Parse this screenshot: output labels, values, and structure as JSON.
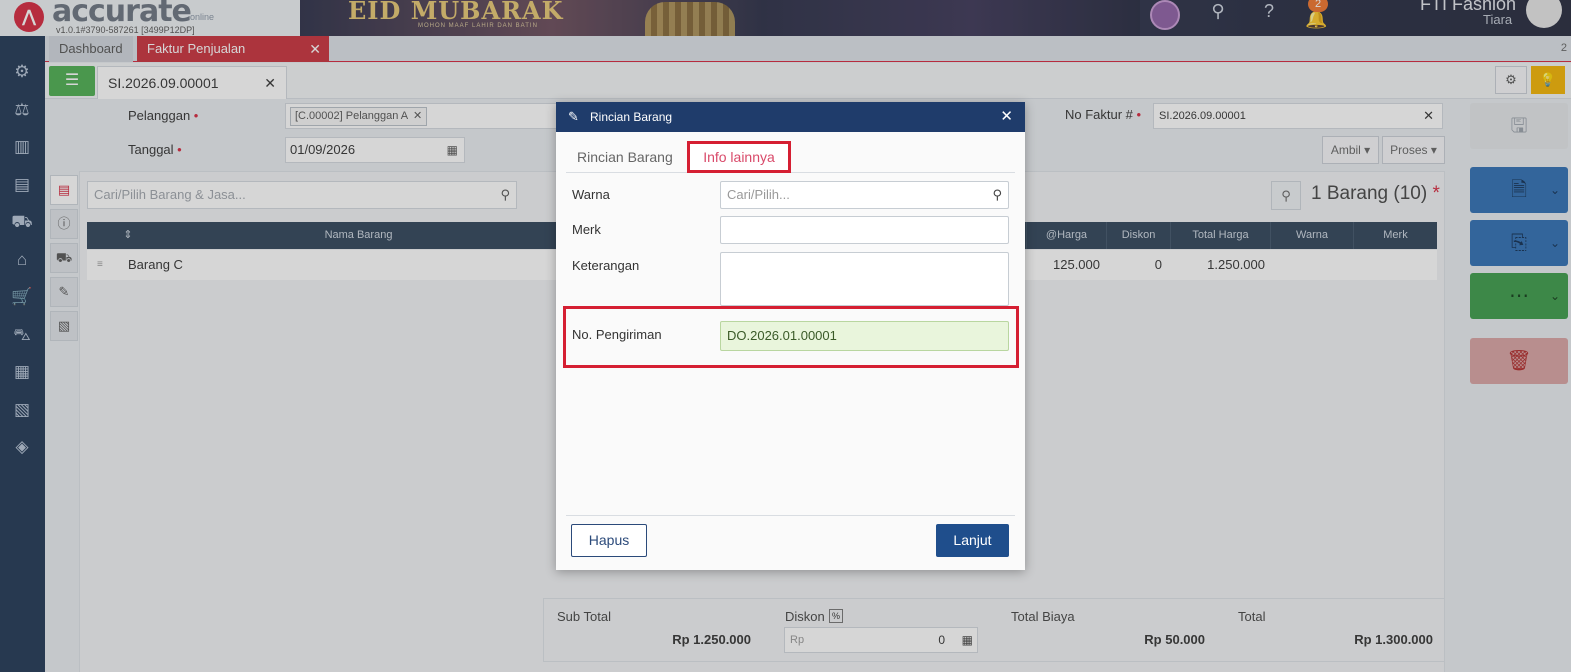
{
  "app": {
    "logo_text": "accurate",
    "logo_sub": "online",
    "version": "v1.0.1#3790-587261 [3499P12DP]",
    "banner_text": "EID MUBARAK",
    "banner_sub": "MOHON MAAF LAHIR DAN BATIN",
    "notification_count": "2",
    "company_name": "FTI Fashion",
    "user_name": "Tiara"
  },
  "tabs": {
    "dashboard": "Dashboard",
    "faktur": "Faktur Penjualan",
    "count": "2"
  },
  "document": {
    "tab_title": "SI.2026.09.00001"
  },
  "form": {
    "pelanggan_label": "Pelanggan",
    "pelanggan_value": "[C.00002] Pelanggan A",
    "tanggal_label": "Tanggal",
    "tanggal_value": "01/09/2026",
    "nofaktur_label": "No Faktur #",
    "nofaktur_value": "SI.2026.09.00001",
    "ambil_label": "Ambil",
    "proses_label": "Proses",
    "search_placeholder": "Cari/Pilih Barang & Jasa...",
    "count_label": "1 Barang (10)"
  },
  "grid": {
    "columns": [
      "Nama Barang",
      "@Harga",
      "Diskon",
      "Total Harga",
      "Warna",
      "Merk"
    ],
    "rows": [
      {
        "nama": "Barang C",
        "harga": "125.000",
        "diskon": "0",
        "total": "1.250.000",
        "warna": "",
        "merk": ""
      }
    ]
  },
  "totals": {
    "subtotal_label": "Sub Total",
    "subtotal_value": "Rp 1.250.000",
    "diskon_label": "Diskon",
    "diskon_badge": "%",
    "diskon_prefix": "Rp",
    "diskon_value": "0",
    "biaya_label": "Total Biaya",
    "biaya_value": "Rp 50.000",
    "total_label": "Total",
    "total_value": "Rp 1.300.000"
  },
  "modal": {
    "title": "Rincian Barang",
    "tab_rincian": "Rincian Barang",
    "tab_info": "Info lainnya",
    "warna_label": "Warna",
    "warna_placeholder": "Cari/Pilih...",
    "merk_label": "Merk",
    "merk_value": "",
    "keterangan_label": "Keterangan",
    "keterangan_value": "",
    "pengiriman_label": "No. Pengiriman",
    "pengiriman_value": "DO.2026.01.00001",
    "hapus_label": "Hapus",
    "lanjut_label": "Lanjut"
  },
  "colors": {
    "accent": "#d7263d",
    "nav": "#1f3654",
    "modal_header": "#1f3c6b",
    "highlight": "#d51f32",
    "readonly_green": "#e9f5dc"
  }
}
